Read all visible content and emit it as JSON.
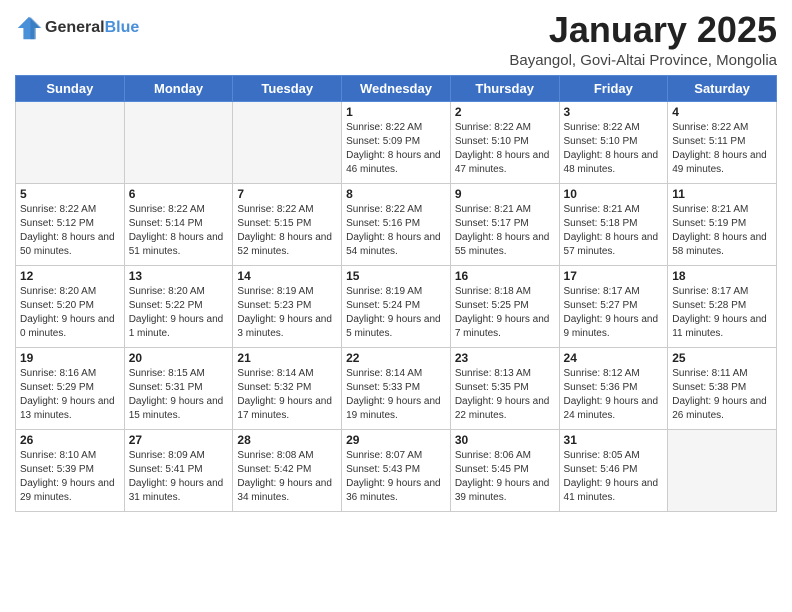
{
  "header": {
    "logo_line1": "General",
    "logo_line2": "Blue",
    "month_title": "January 2025",
    "subtitle": "Bayangol, Govi-Altai Province, Mongolia"
  },
  "weekdays": [
    "Sunday",
    "Monday",
    "Tuesday",
    "Wednesday",
    "Thursday",
    "Friday",
    "Saturday"
  ],
  "weeks": [
    [
      {
        "day": "",
        "info": ""
      },
      {
        "day": "",
        "info": ""
      },
      {
        "day": "",
        "info": ""
      },
      {
        "day": "1",
        "info": "Sunrise: 8:22 AM\nSunset: 5:09 PM\nDaylight: 8 hours and 46 minutes."
      },
      {
        "day": "2",
        "info": "Sunrise: 8:22 AM\nSunset: 5:10 PM\nDaylight: 8 hours and 47 minutes."
      },
      {
        "day": "3",
        "info": "Sunrise: 8:22 AM\nSunset: 5:10 PM\nDaylight: 8 hours and 48 minutes."
      },
      {
        "day": "4",
        "info": "Sunrise: 8:22 AM\nSunset: 5:11 PM\nDaylight: 8 hours and 49 minutes."
      }
    ],
    [
      {
        "day": "5",
        "info": "Sunrise: 8:22 AM\nSunset: 5:12 PM\nDaylight: 8 hours and 50 minutes."
      },
      {
        "day": "6",
        "info": "Sunrise: 8:22 AM\nSunset: 5:14 PM\nDaylight: 8 hours and 51 minutes."
      },
      {
        "day": "7",
        "info": "Sunrise: 8:22 AM\nSunset: 5:15 PM\nDaylight: 8 hours and 52 minutes."
      },
      {
        "day": "8",
        "info": "Sunrise: 8:22 AM\nSunset: 5:16 PM\nDaylight: 8 hours and 54 minutes."
      },
      {
        "day": "9",
        "info": "Sunrise: 8:21 AM\nSunset: 5:17 PM\nDaylight: 8 hours and 55 minutes."
      },
      {
        "day": "10",
        "info": "Sunrise: 8:21 AM\nSunset: 5:18 PM\nDaylight: 8 hours and 57 minutes."
      },
      {
        "day": "11",
        "info": "Sunrise: 8:21 AM\nSunset: 5:19 PM\nDaylight: 8 hours and 58 minutes."
      }
    ],
    [
      {
        "day": "12",
        "info": "Sunrise: 8:20 AM\nSunset: 5:20 PM\nDaylight: 9 hours and 0 minutes."
      },
      {
        "day": "13",
        "info": "Sunrise: 8:20 AM\nSunset: 5:22 PM\nDaylight: 9 hours and 1 minute."
      },
      {
        "day": "14",
        "info": "Sunrise: 8:19 AM\nSunset: 5:23 PM\nDaylight: 9 hours and 3 minutes."
      },
      {
        "day": "15",
        "info": "Sunrise: 8:19 AM\nSunset: 5:24 PM\nDaylight: 9 hours and 5 minutes."
      },
      {
        "day": "16",
        "info": "Sunrise: 8:18 AM\nSunset: 5:25 PM\nDaylight: 9 hours and 7 minutes."
      },
      {
        "day": "17",
        "info": "Sunrise: 8:17 AM\nSunset: 5:27 PM\nDaylight: 9 hours and 9 minutes."
      },
      {
        "day": "18",
        "info": "Sunrise: 8:17 AM\nSunset: 5:28 PM\nDaylight: 9 hours and 11 minutes."
      }
    ],
    [
      {
        "day": "19",
        "info": "Sunrise: 8:16 AM\nSunset: 5:29 PM\nDaylight: 9 hours and 13 minutes."
      },
      {
        "day": "20",
        "info": "Sunrise: 8:15 AM\nSunset: 5:31 PM\nDaylight: 9 hours and 15 minutes."
      },
      {
        "day": "21",
        "info": "Sunrise: 8:14 AM\nSunset: 5:32 PM\nDaylight: 9 hours and 17 minutes."
      },
      {
        "day": "22",
        "info": "Sunrise: 8:14 AM\nSunset: 5:33 PM\nDaylight: 9 hours and 19 minutes."
      },
      {
        "day": "23",
        "info": "Sunrise: 8:13 AM\nSunset: 5:35 PM\nDaylight: 9 hours and 22 minutes."
      },
      {
        "day": "24",
        "info": "Sunrise: 8:12 AM\nSunset: 5:36 PM\nDaylight: 9 hours and 24 minutes."
      },
      {
        "day": "25",
        "info": "Sunrise: 8:11 AM\nSunset: 5:38 PM\nDaylight: 9 hours and 26 minutes."
      }
    ],
    [
      {
        "day": "26",
        "info": "Sunrise: 8:10 AM\nSunset: 5:39 PM\nDaylight: 9 hours and 29 minutes."
      },
      {
        "day": "27",
        "info": "Sunrise: 8:09 AM\nSunset: 5:41 PM\nDaylight: 9 hours and 31 minutes."
      },
      {
        "day": "28",
        "info": "Sunrise: 8:08 AM\nSunset: 5:42 PM\nDaylight: 9 hours and 34 minutes."
      },
      {
        "day": "29",
        "info": "Sunrise: 8:07 AM\nSunset: 5:43 PM\nDaylight: 9 hours and 36 minutes."
      },
      {
        "day": "30",
        "info": "Sunrise: 8:06 AM\nSunset: 5:45 PM\nDaylight: 9 hours and 39 minutes."
      },
      {
        "day": "31",
        "info": "Sunrise: 8:05 AM\nSunset: 5:46 PM\nDaylight: 9 hours and 41 minutes."
      },
      {
        "day": "",
        "info": ""
      }
    ]
  ]
}
